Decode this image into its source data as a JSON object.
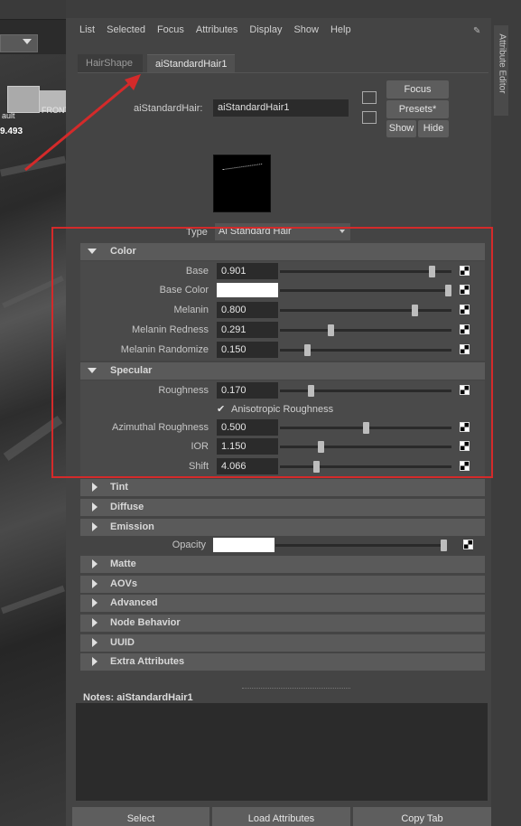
{
  "viewport": {
    "labels": [
      "ault",
      "FRONT"
    ],
    "readout": "9.493"
  },
  "menu": [
    "List",
    "Selected",
    "Focus",
    "Attributes",
    "Display",
    "Show",
    "Help"
  ],
  "tabs": [
    "HairShape",
    "aiStandardHair1"
  ],
  "side_tab": "Attribute Editor",
  "node": {
    "label": "aiStandardHair:",
    "value": "aiStandardHair1",
    "buttons": {
      "focus": "Focus",
      "presets": "Presets*",
      "show": "Show",
      "hide": "Hide"
    }
  },
  "type": {
    "label": "Type",
    "value": "Ai Standard Hair"
  },
  "sections": {
    "color": "Color",
    "specular": "Specular",
    "tint": "Tint",
    "diffuse": "Diffuse",
    "emission": "Emission",
    "matte": "Matte",
    "aovs": "AOVs",
    "advanced": "Advanced",
    "node_behavior": "Node Behavior",
    "uuid": "UUID",
    "extra": "Extra Attributes"
  },
  "color_attrs": [
    {
      "label": "Base",
      "value": "0.901",
      "slider": 0.901
    },
    {
      "label": "Base Color",
      "value": "",
      "slider": 1.0
    },
    {
      "label": "Melanin",
      "value": "0.800",
      "slider": 0.8
    },
    {
      "label": "Melanin Redness",
      "value": "0.291",
      "slider": 0.291
    },
    {
      "label": "Melanin Randomize",
      "value": "0.150",
      "slider": 0.15
    }
  ],
  "specular_attrs": {
    "roughness": {
      "label": "Roughness",
      "value": "0.170",
      "slider": 0.17
    },
    "aniso": {
      "label": "Anisotropic Roughness",
      "checked": true
    },
    "azimuthal": {
      "label": "Azimuthal Roughness",
      "value": "0.500",
      "slider": 0.5
    },
    "ior": {
      "label": "IOR",
      "value": "1.150",
      "slider": 0.23
    },
    "shift": {
      "label": "Shift",
      "value": "4.066",
      "slider": 0.2
    }
  },
  "opacity": {
    "label": "Opacity",
    "slider": 1.0
  },
  "notes": {
    "label": "Notes:  aiStandardHair1"
  },
  "bottom_buttons": [
    "Select",
    "Load Attributes",
    "Copy Tab"
  ],
  "colors": {
    "highlight_box": "#d42a2a",
    "panel_bg": "#444444",
    "field_bg": "#2b2b2b"
  }
}
